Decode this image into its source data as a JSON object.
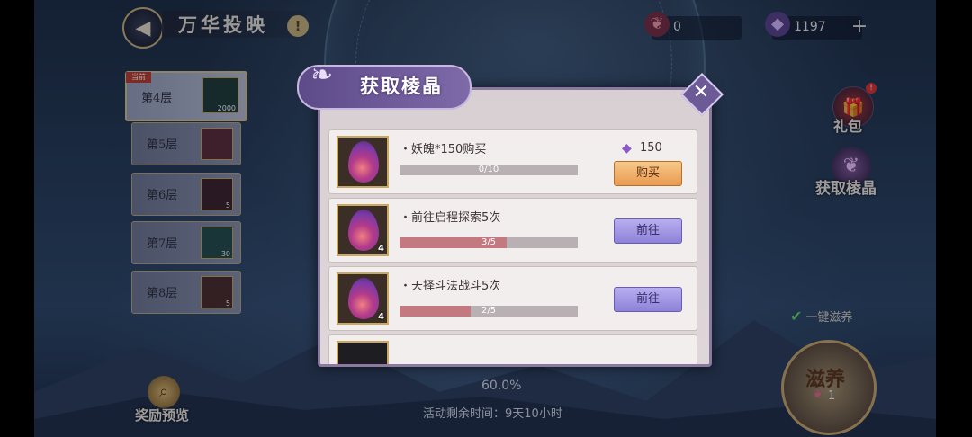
{
  "header": {
    "title": "万华投映",
    "hint_icon": "!",
    "resources": [
      {
        "icon": "demon-soul-icon",
        "value": "0"
      },
      {
        "icon": "crystal-icon",
        "value": "1197"
      }
    ],
    "plus": "+"
  },
  "floors": {
    "current_tag": "当前",
    "items": [
      {
        "label": "第4层",
        "count": "2000"
      },
      {
        "label": "第5层",
        "count": ""
      },
      {
        "label": "第6层",
        "count": "5"
      },
      {
        "label": "第7层",
        "count": "30"
      },
      {
        "label": "第8层",
        "count": "5"
      }
    ]
  },
  "side": {
    "gift_label": "礼包",
    "gift_badge": "!",
    "crystal_label": "获取棱晶",
    "onekey_label": "一键滋养",
    "nourish_label": "滋养",
    "nourish_count": "1"
  },
  "bottom": {
    "preview_label": "奖励预览",
    "progress": "60.0%",
    "remaining": "活动剩余时间：9天10小时"
  },
  "popup": {
    "title": "获取棱晶",
    "close": "✕",
    "tasks": [
      {
        "name": "・妖魄*150购买",
        "progress_text": "0/10",
        "progress": 0.0,
        "qty": "",
        "cost": "150",
        "button": "购买"
      },
      {
        "name": "・前往启程探索5次",
        "progress_text": "3/5",
        "progress": 0.6,
        "qty": "4",
        "button": "前往"
      },
      {
        "name": "・天择斗法战斗5次",
        "progress_text": "2/5",
        "progress": 0.4,
        "qty": "4",
        "button": "前往"
      }
    ]
  },
  "colors": {
    "accent_purple": "#8d82d8",
    "buy_orange": "#e99a50",
    "progress_fill": "#c27a80"
  }
}
